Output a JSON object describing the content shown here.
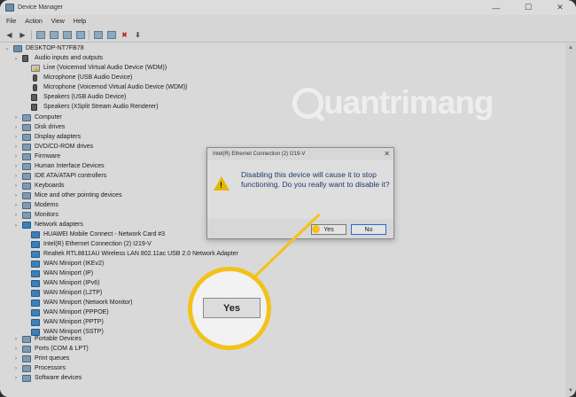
{
  "window": {
    "title": "Device Manager",
    "controls": {
      "minimize": "—",
      "maximize": "☐",
      "close": "✕"
    }
  },
  "menu": {
    "items": [
      "File",
      "Action",
      "View",
      "Help"
    ]
  },
  "toolbar": {
    "back": "◀",
    "forward": "▶",
    "remove": "✖",
    "update": "⬇"
  },
  "tree": {
    "root": "DESKTOP-NT7FB78",
    "audio": {
      "label": "Audio inputs and outputs",
      "children": [
        "Line (Voicemod Virtual Audio Device (WDM))",
        "Microphone (USB Audio Device)",
        "Microphone (Voicemod Virtual Audio Device (WDM))",
        "Speakers (USB Audio Device)",
        "Speakers (XSplit Stream Audio Renderer)"
      ]
    },
    "categories_top": [
      "Computer",
      "Disk drives",
      "Display adapters",
      "DVD/CD-ROM drives",
      "Firmware",
      "Human Interface Devices",
      "IDE ATA/ATAPI controllers",
      "Keyboards",
      "Mice and other pointing devices",
      "Modems",
      "Monitors"
    ],
    "network": {
      "label": "Network adapters",
      "children": [
        "HUAWEI Mobile Connect - Network Card #3",
        "Intel(R) Ethernet Connection (2) I219-V",
        "Realtek RTL8811AU Wireless LAN 802.11ac USB 2.0 Network Adapter",
        "WAN Miniport (IKEv2)",
        "WAN Miniport (IP)",
        "WAN Miniport (IPv6)",
        "WAN Miniport (L2TP)",
        "WAN Miniport (Network Monitor)",
        "WAN Miniport (PPPOE)",
        "WAN Miniport (PPTP)",
        "WAN Miniport (SSTP)"
      ]
    },
    "categories_bottom": [
      "Portable Devices",
      "Ports (COM & LPT)",
      "Print queues",
      "Processors",
      "Software devices"
    ],
    "expanded_glyph": "⌄",
    "collapsed_glyph": "›"
  },
  "watermark": {
    "text": "uantrimang"
  },
  "dialog": {
    "title": "Intel(R) Ethernet Connection (2) I219-V",
    "close": "✕",
    "message": "Disabling this device will cause it to stop functioning. Do you really want to disable it?",
    "warn_mark": "!",
    "yes_label": "Yes",
    "no_label": "No"
  },
  "callout": {
    "label": "Yes",
    "color": "#f2c21b"
  },
  "scroll": {
    "up": "▲",
    "down": "▼"
  }
}
